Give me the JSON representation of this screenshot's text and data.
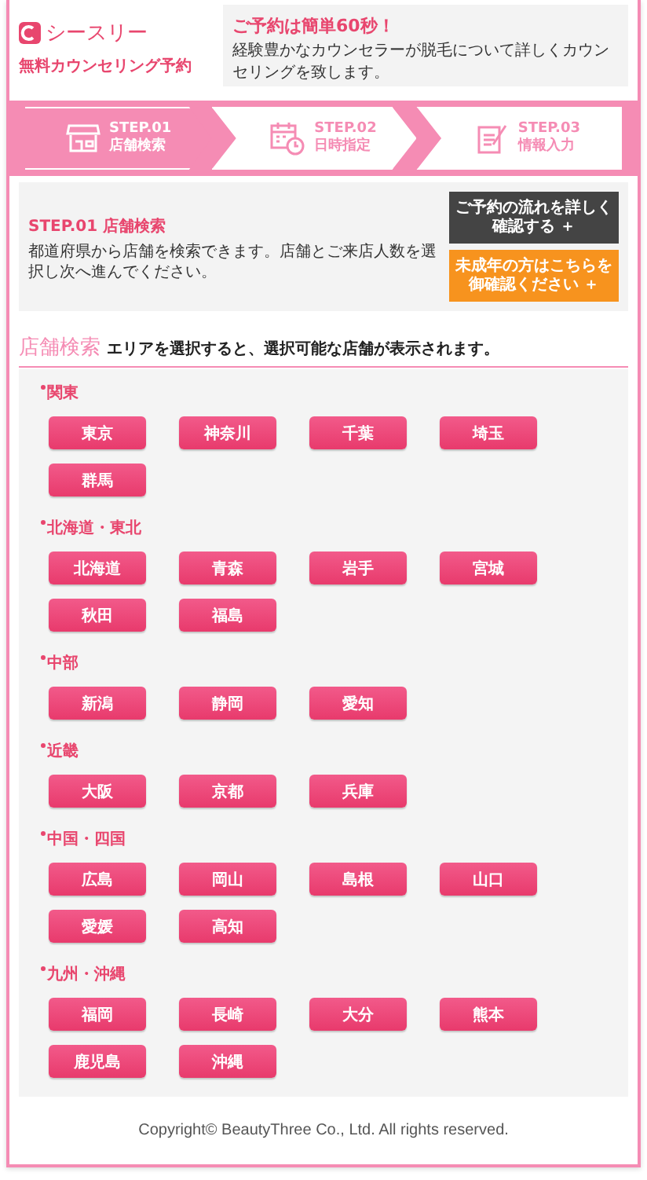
{
  "header": {
    "brand": "シースリー",
    "subtitle": "無料カウンセリング予約",
    "promo": {
      "title": "ご予約は簡単60秒！",
      "text": "経験豊かなカウンセラーが脱毛について詳しくカウンセリングを致します。"
    }
  },
  "steps": [
    {
      "kind": "store",
      "number": "STEP.01",
      "label": "店舗検索",
      "selected": true
    },
    {
      "kind": "calendar",
      "number": "STEP.02",
      "label": "日時指定",
      "selected": false
    },
    {
      "kind": "form",
      "number": "STEP.03",
      "label": "情報入力",
      "selected": false
    }
  ],
  "intro": {
    "title": "STEP.01 店舗検索",
    "text": "都道府県から店舗を検索できます。店舗とご来店人数を選択し次へ進んでください。",
    "buttons": [
      {
        "kind": "dark",
        "label": "ご予約の流れを詳しく確認する ＋"
      },
      {
        "kind": "orange",
        "label": "未成年の方はこちらを御確認ください ＋"
      }
    ]
  },
  "search": {
    "title": "店舗検索",
    "hint": "エリアを選択すると、選択可能な店舗が表示されます。"
  },
  "regions": [
    {
      "name": "関東",
      "prefectures": [
        "東京",
        "神奈川",
        "千葉",
        "埼玉",
        "群馬"
      ]
    },
    {
      "name": "北海道・東北",
      "prefectures": [
        "北海道",
        "青森",
        "岩手",
        "宮城",
        "秋田",
        "福島"
      ]
    },
    {
      "name": "中部",
      "prefectures": [
        "新潟",
        "静岡",
        "愛知"
      ]
    },
    {
      "name": "近畿",
      "prefectures": [
        "大阪",
        "京都",
        "兵庫"
      ]
    },
    {
      "name": "中国・四国",
      "prefectures": [
        "広島",
        "岡山",
        "島根",
        "山口",
        "愛媛",
        "高知"
      ]
    },
    {
      "name": "九州・沖縄",
      "prefectures": [
        "福岡",
        "長崎",
        "大分",
        "熊本",
        "鹿児島",
        "沖縄"
      ]
    }
  ],
  "footer": "Copyright© BeautyThree Co., Ltd. All rights reserved."
}
